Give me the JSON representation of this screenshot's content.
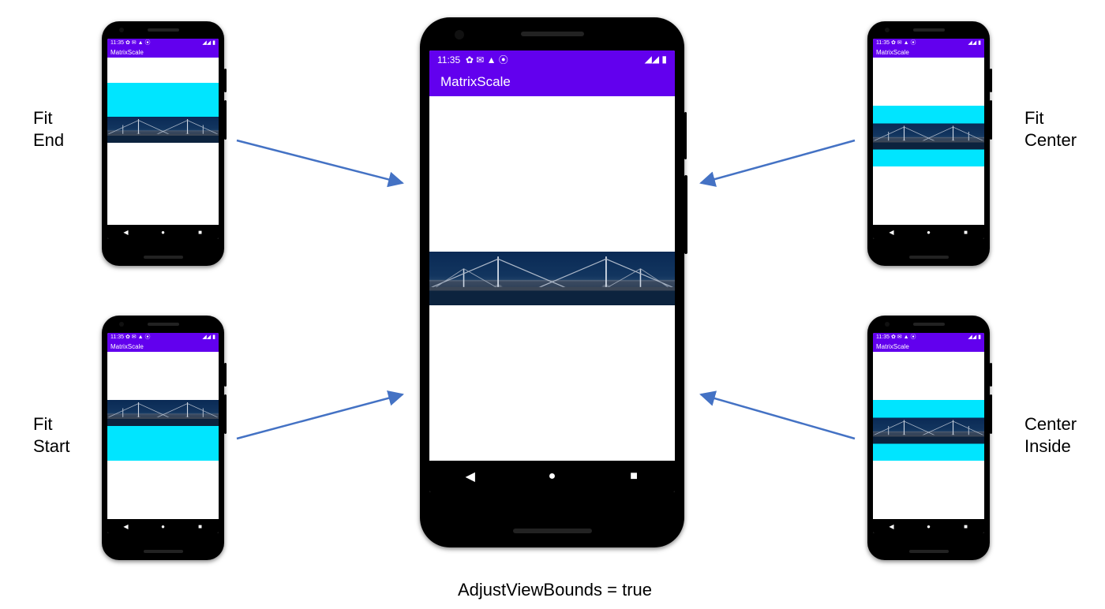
{
  "app_title": "MatrixScale",
  "status_time": "11:35",
  "status_icons_left": "✿ ✉ ▲ ⦿",
  "status_icons_right": "◢◢ ▮",
  "nav": {
    "back": "◀",
    "home": "●",
    "recent": "■"
  },
  "labels": {
    "fit_end": "Fit\nEnd",
    "fit_start": "Fit\nStart",
    "fit_center": "Fit\nCenter",
    "center_inside": "Center\nInside"
  },
  "caption": "AdjustViewBounds = true",
  "colors": {
    "accent": "#6200EE",
    "cyan": "#00E5FF",
    "arrow": "#4472C4"
  },
  "variants": {
    "fit_end": {
      "cyan_top_pct": 15,
      "cyan_height_pct": 36,
      "image_position": "bottom"
    },
    "fit_start": {
      "cyan_top_pct": 29,
      "cyan_height_pct": 36,
      "image_position": "top"
    },
    "fit_center": {
      "cyan_top_pct": 29,
      "cyan_height_pct": 36,
      "image_position": "center"
    },
    "center_inside": {
      "cyan_top_pct": 29,
      "cyan_height_pct": 36,
      "image_position": "center"
    },
    "main": {
      "image_position": "center"
    }
  }
}
